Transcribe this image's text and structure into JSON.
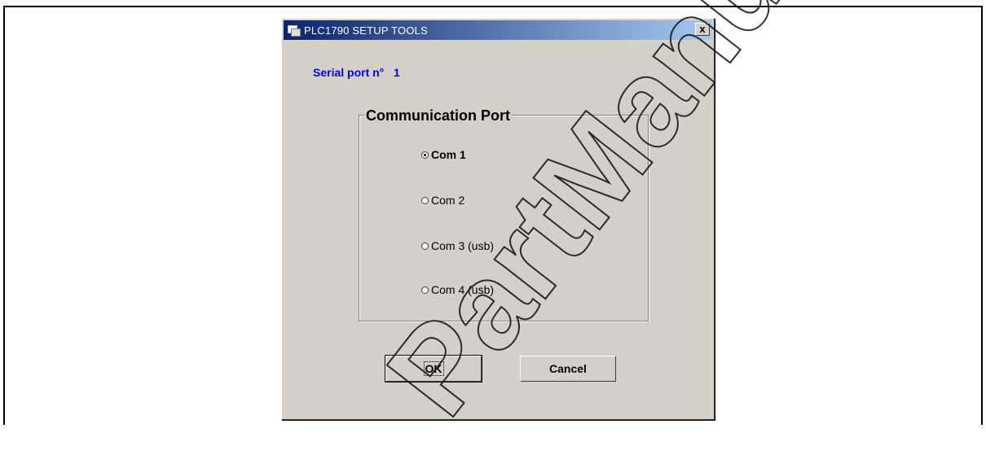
{
  "dialog": {
    "title": "PLC1790 SETUP TOOLS",
    "close_glyph": "x",
    "serial_label": "Serial port n°   1",
    "group_title": "Communication Port",
    "options": [
      {
        "label": "Com 1",
        "selected": true
      },
      {
        "label": "Com 2",
        "selected": false
      },
      {
        "label": "Com 3  (usb)",
        "selected": false
      },
      {
        "label": "Com 4  (usb)",
        "selected": false
      }
    ],
    "ok_label": "OK",
    "cancel_label": "Cancel"
  },
  "watermark": {
    "text": "ManualsLib PartManuals",
    "color": "#1a1a1a"
  },
  "colors": {
    "dialog_bg": "#d4d0c8",
    "title_start": "#0a246a",
    "title_end": "#a6caf0",
    "serial_text": "#0000ff"
  }
}
